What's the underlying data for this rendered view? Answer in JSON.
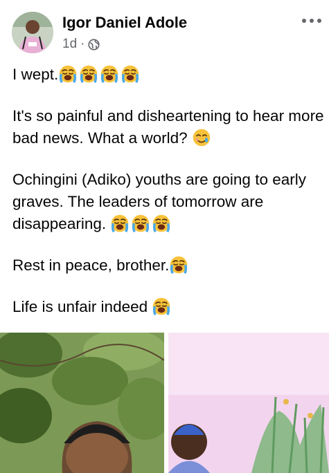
{
  "post": {
    "author": "Igor Daniel Adole",
    "time": "1d",
    "separator": "·",
    "lines": {
      "l1": "I wept.",
      "l2": "It's so painful and disheartening to hear more bad news. What a world?",
      "l3": "Ochingini (Adiko) youths are going to early graves. The leaders of tomorrow are disappearing.",
      "l4": "Rest in peace, brother.",
      "l5": "Life is unfair indeed"
    }
  },
  "icons": {
    "more": "more-options-icon",
    "privacy": "globe-icon",
    "emoji_cry": "loudly-crying-face-emoji",
    "emoji_tear": "smiling-face-with-tear-emoji"
  },
  "colors": {
    "text": "#050505",
    "meta": "#65676b",
    "emoji_face": "#f7c23a",
    "emoji_tear": "#4aa8e8"
  }
}
